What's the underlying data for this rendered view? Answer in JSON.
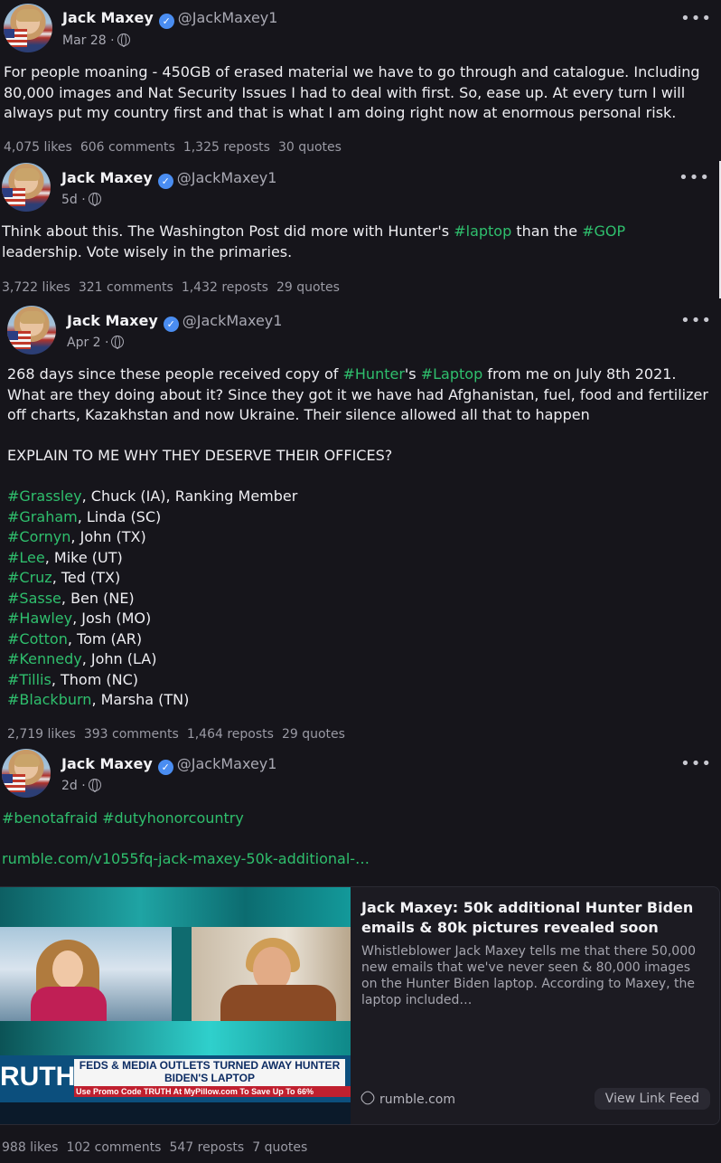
{
  "posts": [
    {
      "author": "Jack Maxey",
      "handle": "@JackMaxey1",
      "date": "Mar 28",
      "text": "For people moaning - 450GB of erased material we have to go through and catalogue. Including 80,000 images and Nat Security Issues I had to deal with first. So, ease up. At every turn I will always put my country first and that is what I am doing right now at enormous personal risk.",
      "stats": {
        "likes": "4,075 likes",
        "comments": "606 comments",
        "reposts": "1,325 reposts",
        "quotes": "30 quotes"
      }
    },
    {
      "author": "Jack Maxey",
      "handle": "@JackMaxey1",
      "date": "5d",
      "text_parts": [
        "Think about this. The Washington Post did more with Hunter's ",
        "#laptop",
        " than the ",
        "#GOP",
        " leadership. Vote wisely in the primaries."
      ],
      "stats": {
        "likes": "3,722 likes",
        "comments": "321 comments",
        "reposts": "1,432 reposts",
        "quotes": "29 quotes"
      }
    },
    {
      "author": "Jack Maxey",
      "handle": "@JackMaxey1",
      "date": "Apr 2",
      "intro_parts": [
        "268 days since these people received copy of ",
        "#Hunter",
        "'s ",
        "#Laptop",
        " from me on July 8th 2021. What are they doing about it? Since they got it we have had Afghanistan, fuel, food and fertilizer off charts, Kazakhstan and now Ukraine. Their silence allowed all that to happen"
      ],
      "explain": "EXPLAIN TO ME WHY THEY DESERVE THEIR OFFICES?",
      "members": [
        {
          "tag": "#Grassley",
          "rest": ", Chuck (IA), Ranking Member"
        },
        {
          "tag": "#Graham",
          "rest": ", Linda (SC)"
        },
        {
          "tag": "#Cornyn",
          "rest": ", John (TX)"
        },
        {
          "tag": "#Lee",
          "rest": ", Mike (UT)"
        },
        {
          "tag": "#Cruz",
          "rest": ", Ted (TX)"
        },
        {
          "tag": "#Sasse",
          "rest": ", Ben (NE)"
        },
        {
          "tag": "#Hawley",
          "rest": ", Josh (MO)"
        },
        {
          "tag": "#Cotton",
          "rest": ", Tom (AR)"
        },
        {
          "tag": "#Kennedy",
          "rest": ", John (LA)"
        },
        {
          "tag": "#Tillis",
          "rest": ", Thom (NC)"
        },
        {
          "tag": "#Blackburn",
          "rest": ", Marsha (TN)"
        }
      ],
      "stats": {
        "likes": "2,719 likes",
        "comments": "393 comments",
        "reposts": "1,464 reposts",
        "quotes": "29 quotes"
      }
    },
    {
      "author": "Jack Maxey",
      "handle": "@JackMaxey1",
      "date": "2d",
      "hashtags": "#benotafraid #dutyhonorcountry",
      "link": "rumble.com/v1055fq-jack-maxey-50k-additional-…",
      "card": {
        "title": "Jack Maxey: 50k additional Hunter Biden emails & 80k pictures revealed soon",
        "description": "Whistleblower Jack Maxey tells me that there 50,000 new emails that we've never seen & 80,000 images on the Hunter Biden laptop. According to Maxey, the laptop included…",
        "domain": "rumble.com",
        "button": "View Link Feed",
        "thumb_brand": "RUTH",
        "thumb_headline": "FEDS & MEDIA OUTLETS TURNED AWAY HUNTER BIDEN'S LAPTOP",
        "thumb_promo": "Use Promo Code TRUTH At MyPillow.com To Save Up To 66%"
      },
      "stats": {
        "likes": "988 likes",
        "comments": "102 comments",
        "reposts": "547 reposts",
        "quotes": "7 quotes"
      }
    }
  ],
  "ui": {
    "more": "•••",
    "verified": "✓",
    "dot": "·"
  },
  "colors": {
    "background": "#16151b",
    "hashtag": "#2fbf6d",
    "verified": "#4a8df1",
    "muted": "#a9a9b3"
  },
  "icons": [
    "verified-badge-icon",
    "globe-icon",
    "more-options-icon",
    "link-icon"
  ]
}
